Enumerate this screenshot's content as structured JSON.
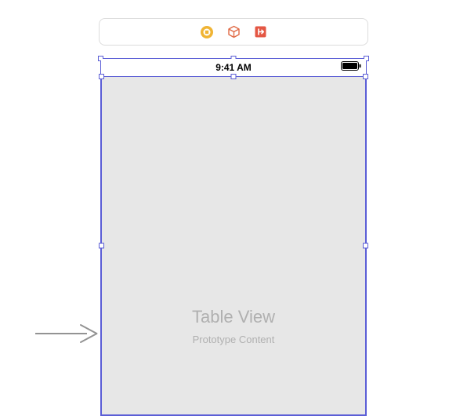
{
  "toolbar": {
    "icons": {
      "first": "view-controller-icon",
      "second": "scene-dock-icon",
      "third": "exit-icon"
    }
  },
  "statusBar": {
    "time": "9:41 AM"
  },
  "tableView": {
    "title": "Table View",
    "subtitle": "Prototype Content"
  },
  "colors": {
    "selection": "#5b5ed6",
    "canvasFill": "#e7e7e7",
    "yellowIcon": "#f0b434",
    "orangeIcon": "#e06a45",
    "redOrangeIcon": "#e45744"
  }
}
